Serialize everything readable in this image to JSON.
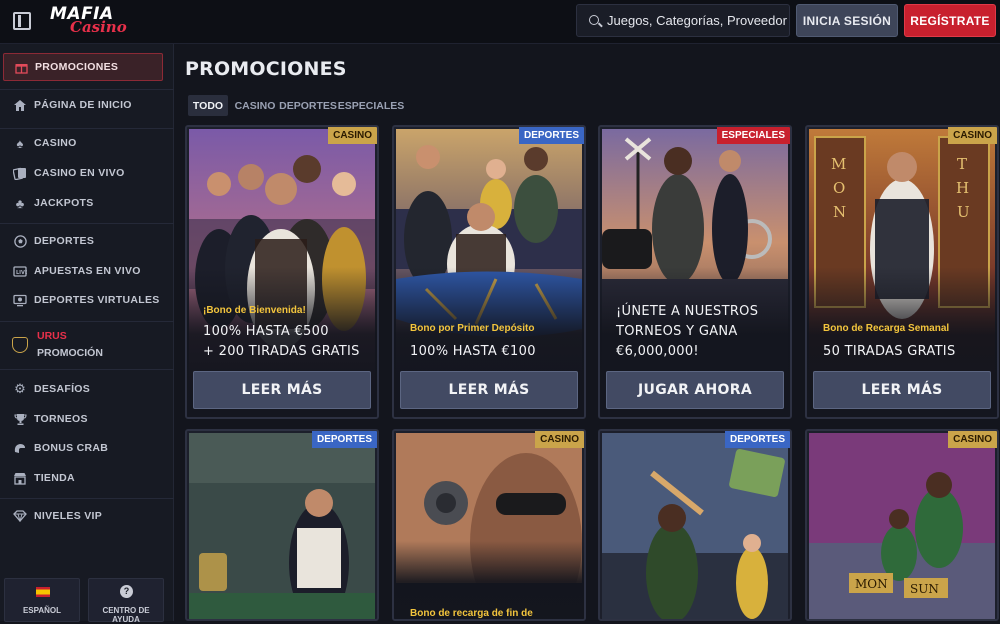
{
  "header": {
    "logo_main": "MAFIA",
    "logo_script": "Casino",
    "search_placeholder": "Juegos, Categorías, Proveedores",
    "login_label": "INICIA SESIÓN",
    "register_label": "REGÍSTRATE"
  },
  "sidebar": {
    "promociones": "PROMOCIONES",
    "inicio": "PÁGINA DE INICIO",
    "casino": "CASINO",
    "casino_vivo": "CASINO EN VIVO",
    "jackpots": "JACKPOTS",
    "deportes": "DEPORTES",
    "apuestas_vivo": "APUESTAS EN VIVO",
    "deportes_virtuales": "DEPORTES VIRTUALES",
    "urus": "URUS",
    "promocion": "PROMOCIÓN",
    "desafios": "DESAFÍOS",
    "torneos": "TORNEOS",
    "bonus_crab": "BONUS CRAB",
    "tienda": "TIENDA",
    "niveles_vip": "NIVELES VIP",
    "language": "ESPAÑOL",
    "help": "CENTRO DE AYUDA"
  },
  "main": {
    "title": "PROMOCIONES",
    "tabs": [
      "TODO",
      "CASINO",
      "DEPORTES",
      "ESPECIALES"
    ]
  },
  "cards": [
    {
      "badge": "CASINO",
      "subtitle": "¡Bono de Bienvenida!",
      "line1": "100% HASTA €500",
      "line2": "+ 200 TIRADAS GRATIS",
      "cta": "LEER MÁS"
    },
    {
      "badge": "DEPORTES",
      "subtitle": "Bono por Primer Depósito",
      "line1": "100% HASTA €100",
      "cta": "LEER MÁS"
    },
    {
      "badge": "ESPECIALES",
      "line1": "¡ÚNETE A NUESTROS",
      "line2": "TORNEOS Y GANA",
      "line3": "€6,000,000!",
      "cta": "JUGAR AHORA"
    },
    {
      "badge": "CASINO",
      "subtitle": "Bono de Recarga Semanal",
      "line1": "50 TIRADAS GRATIS",
      "cta": "LEER MÁS"
    },
    {
      "badge": "DEPORTES"
    },
    {
      "badge": "CASINO",
      "subtitle": "Bono de recarga de fin de"
    },
    {
      "badge": "DEPORTES"
    },
    {
      "badge": "CASINO"
    }
  ]
}
